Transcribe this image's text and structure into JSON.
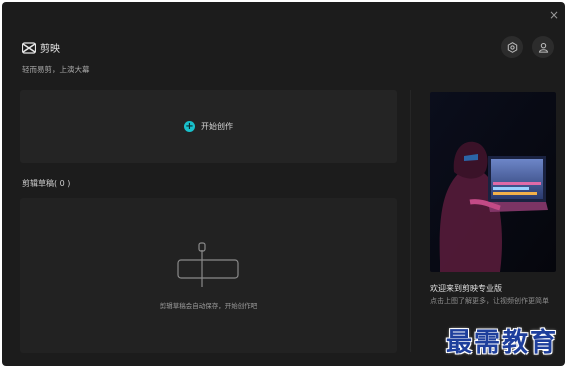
{
  "window": {
    "close_label": "×"
  },
  "brand": {
    "name": "剪映",
    "tagline": "轻而易剪，上演大幕"
  },
  "header": {
    "settings_icon": "settings-icon",
    "user_icon": "user-icon"
  },
  "create": {
    "label": "开始创作",
    "icon": "plus-circle-icon"
  },
  "drafts": {
    "title": "剪辑草稿( 0 )",
    "empty_text": "剪辑草稿会自动保存，开始创作吧"
  },
  "promo": {
    "title": "欢迎来到剪映专业版",
    "description": "点击上图了解更多，让视频创作更简单"
  },
  "watermark": {
    "text": "最需教育"
  },
  "colors": {
    "accent": "#19c1cc",
    "background": "#1c1c1c",
    "watermark": "#1e3f9c"
  }
}
